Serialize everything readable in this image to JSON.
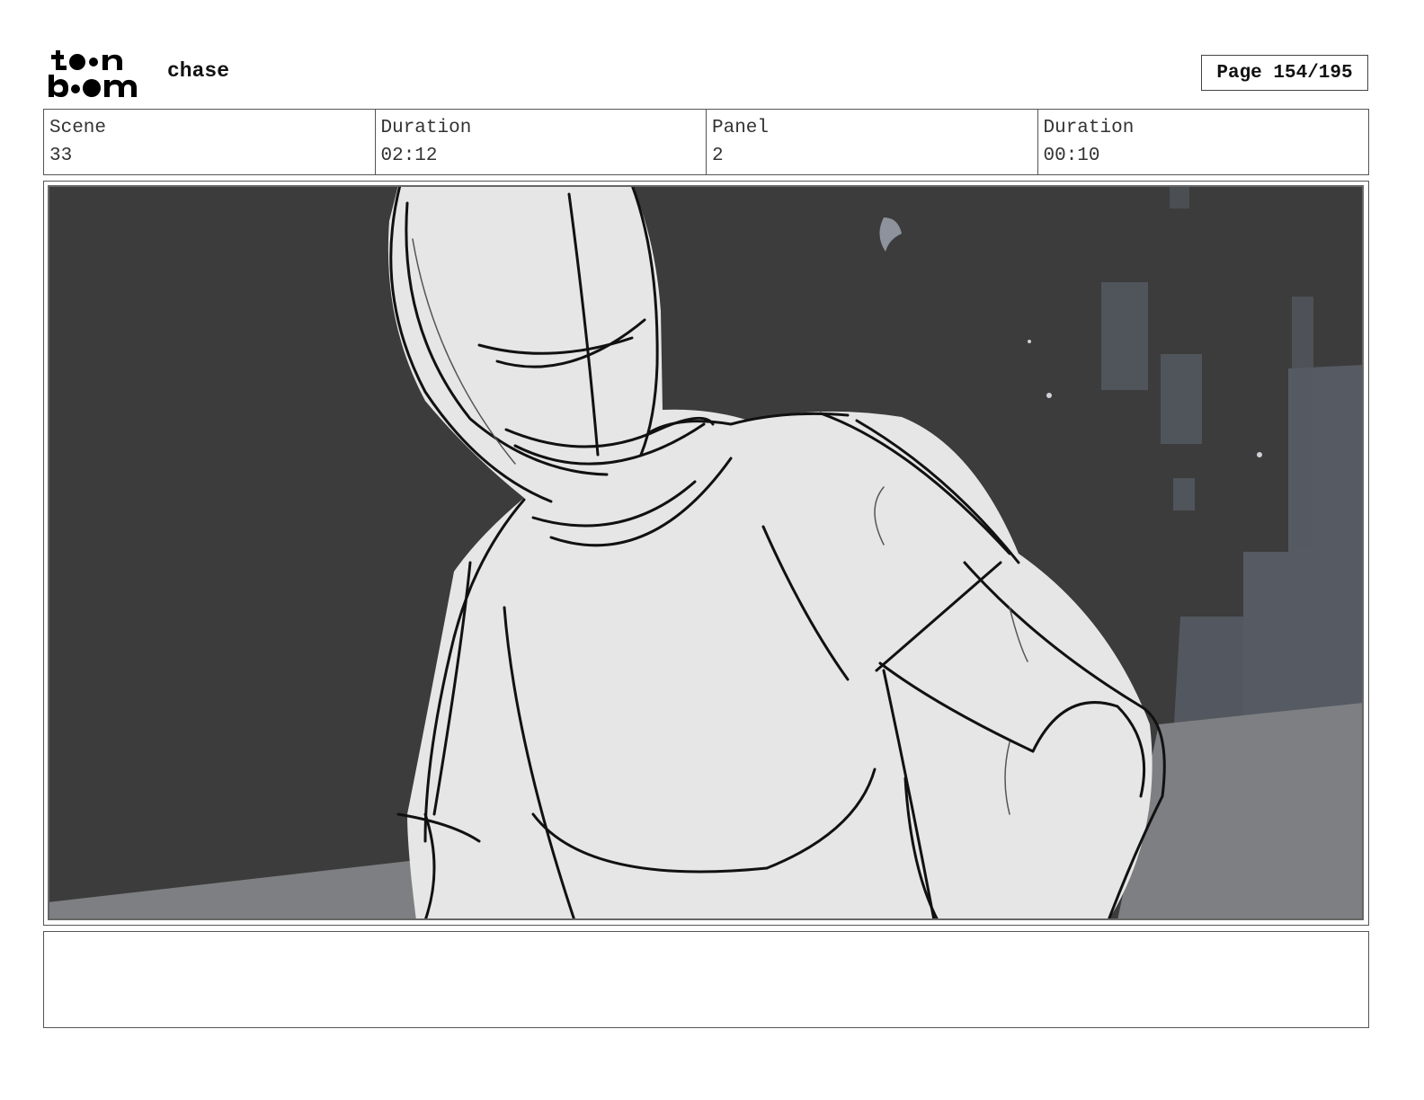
{
  "header": {
    "logo_text": "toon boom",
    "project_title": "chase",
    "page_label": "Page 154/195"
  },
  "info": {
    "scene_label": "Scene",
    "scene_value": "33",
    "scene_duration_label": "Duration",
    "scene_duration_value": "02:12",
    "panel_label": "Panel",
    "panel_value": "2",
    "panel_duration_label": "Duration",
    "panel_duration_value": "00:10"
  },
  "panel": {
    "background_color": "#3c3c3c",
    "figure_color": "#e6e6e6",
    "building_color": "#555a63",
    "ground_color": "#7e7f82"
  },
  "notes": {
    "text": ""
  }
}
